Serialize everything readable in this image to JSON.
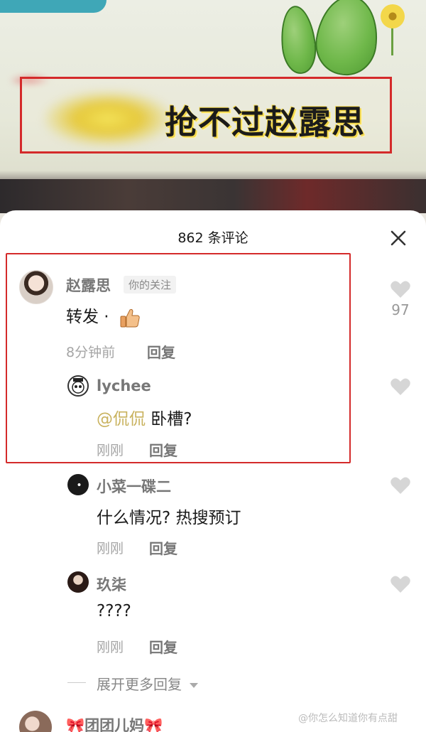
{
  "video": {
    "headline": "抢不过赵露思"
  },
  "sheet": {
    "title": "862 条评论"
  },
  "comments": [
    {
      "author": "赵露思",
      "badge": "你的关注",
      "content": "转发 ·",
      "time": "8分钟前",
      "reply": "回复",
      "likes": "97"
    }
  ],
  "replies": [
    {
      "author": "lychee",
      "mention": "@侃侃",
      "content": " 卧槽?",
      "time": "刚刚",
      "reply": "回复"
    },
    {
      "author": "小菜一碟二",
      "content": "什么情况? 热搜预订",
      "time": "刚刚",
      "reply": "回复"
    },
    {
      "author": "玖柒",
      "content": "????",
      "time": "刚刚",
      "reply": "回复"
    }
  ],
  "expand_label": "展开更多回复",
  "next_comment": {
    "author": "团团儿妈"
  },
  "watermark": "@你怎么知道你有点甜",
  "icons": {
    "close": "close-icon",
    "heart": "heart-icon",
    "thumb": "thumbs-up-icon",
    "chevron": "chevron-down-icon"
  },
  "colors": {
    "highlight": "#d42a2a",
    "mention": "#c9b25e"
  }
}
